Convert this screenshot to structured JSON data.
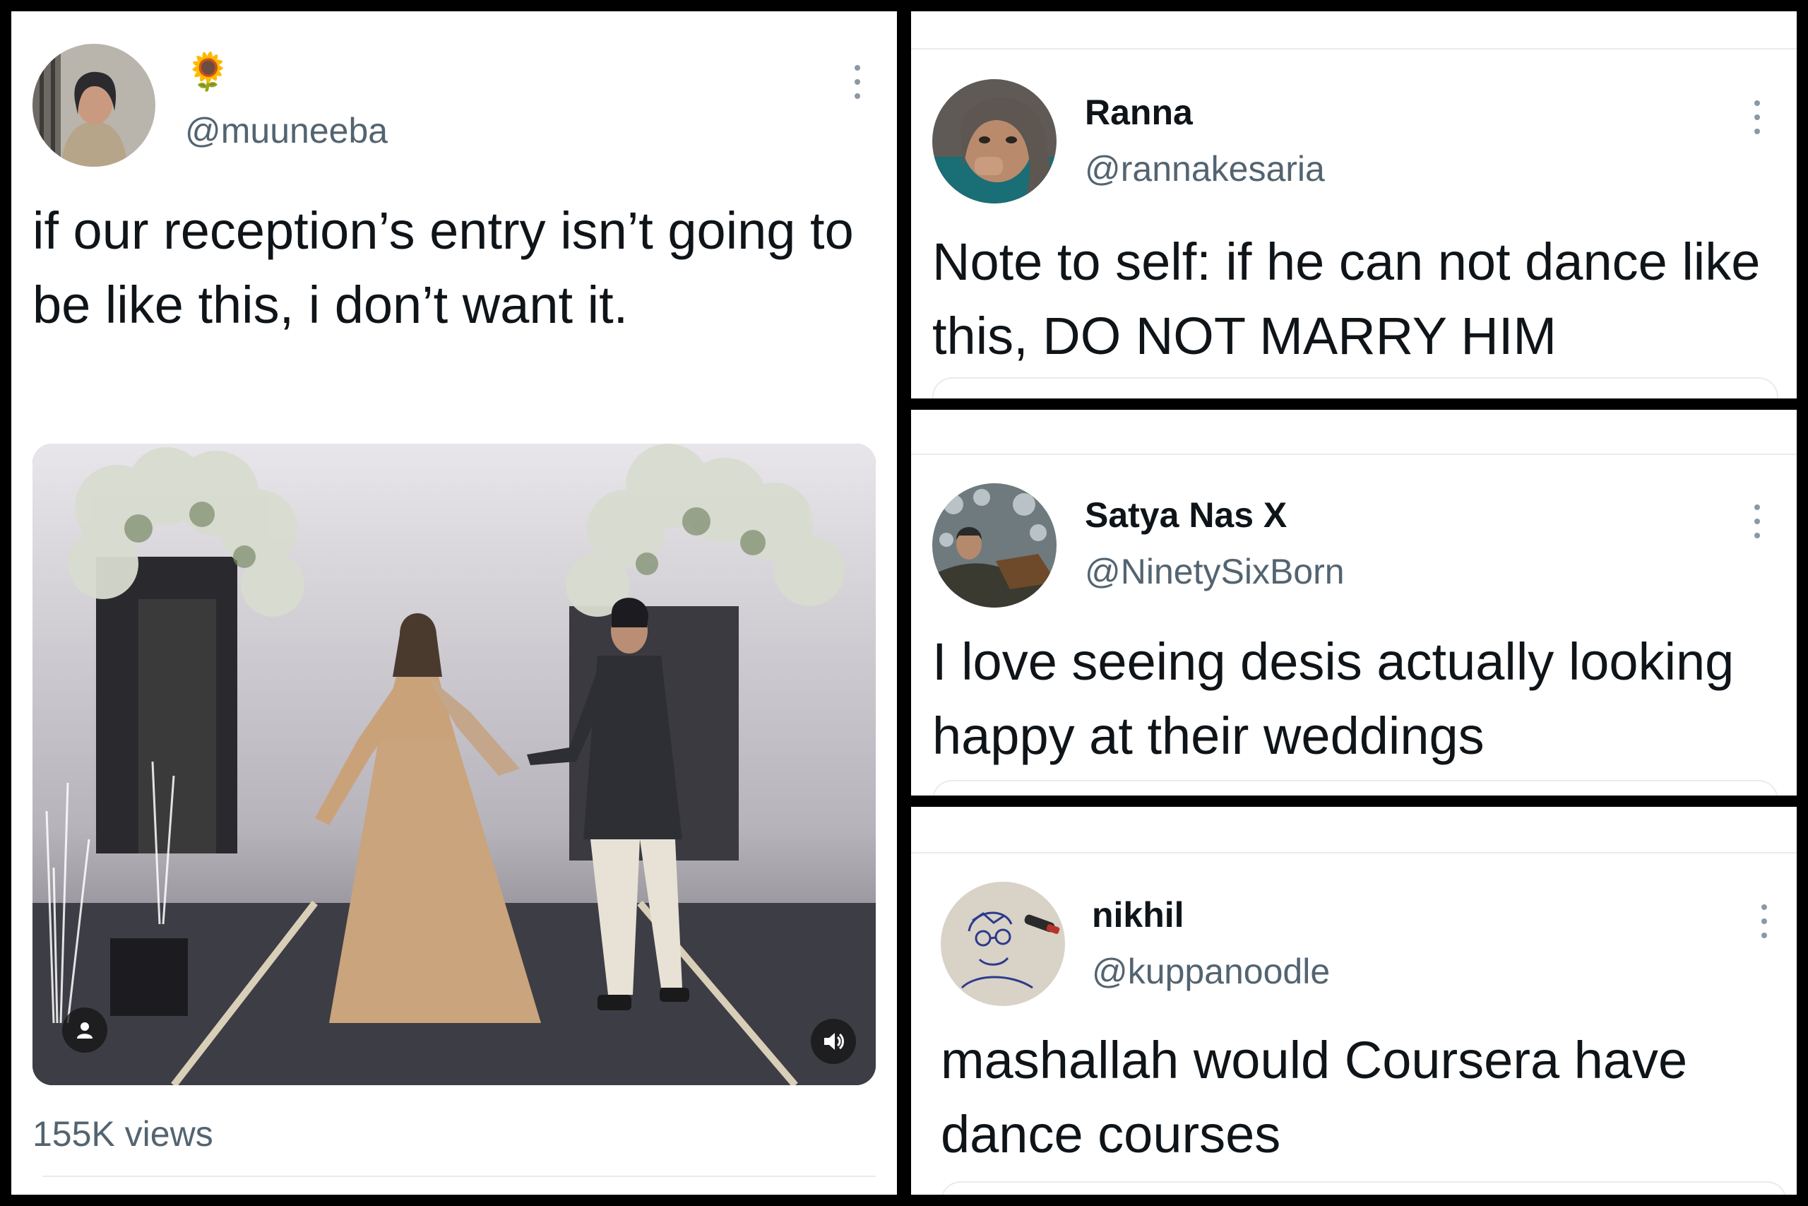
{
  "tweets": {
    "main": {
      "handle": "@muuneeba",
      "emoji": "🌻",
      "text": "if our reception’s entry isn’t going to be like this, i don’t want it.",
      "views": "155K views",
      "avatar_icon": "user-photo",
      "more_icon": "more-vertical-icon",
      "video": {
        "person_icon": "person-icon",
        "volume_icon": "volume-icon"
      }
    },
    "ranna": {
      "name": "Ranna",
      "handle": "@rannakesaria",
      "text": "Note to self: if he can not dance like this, DO NOT MARRY HIM"
    },
    "satya": {
      "name": "Satya Nas X",
      "handle": "@NinetySixBorn",
      "text": "I love seeing desis actually looking happy at their weddings"
    },
    "nikhil": {
      "name": "nikhil",
      "handle": "@kuppanoodle",
      "text": "mashallah would Coursera have dance courses"
    }
  },
  "colors": {
    "text_primary": "#0f1419",
    "text_secondary": "#536471",
    "divider": "#e6ecf0",
    "frame": "#000000"
  }
}
